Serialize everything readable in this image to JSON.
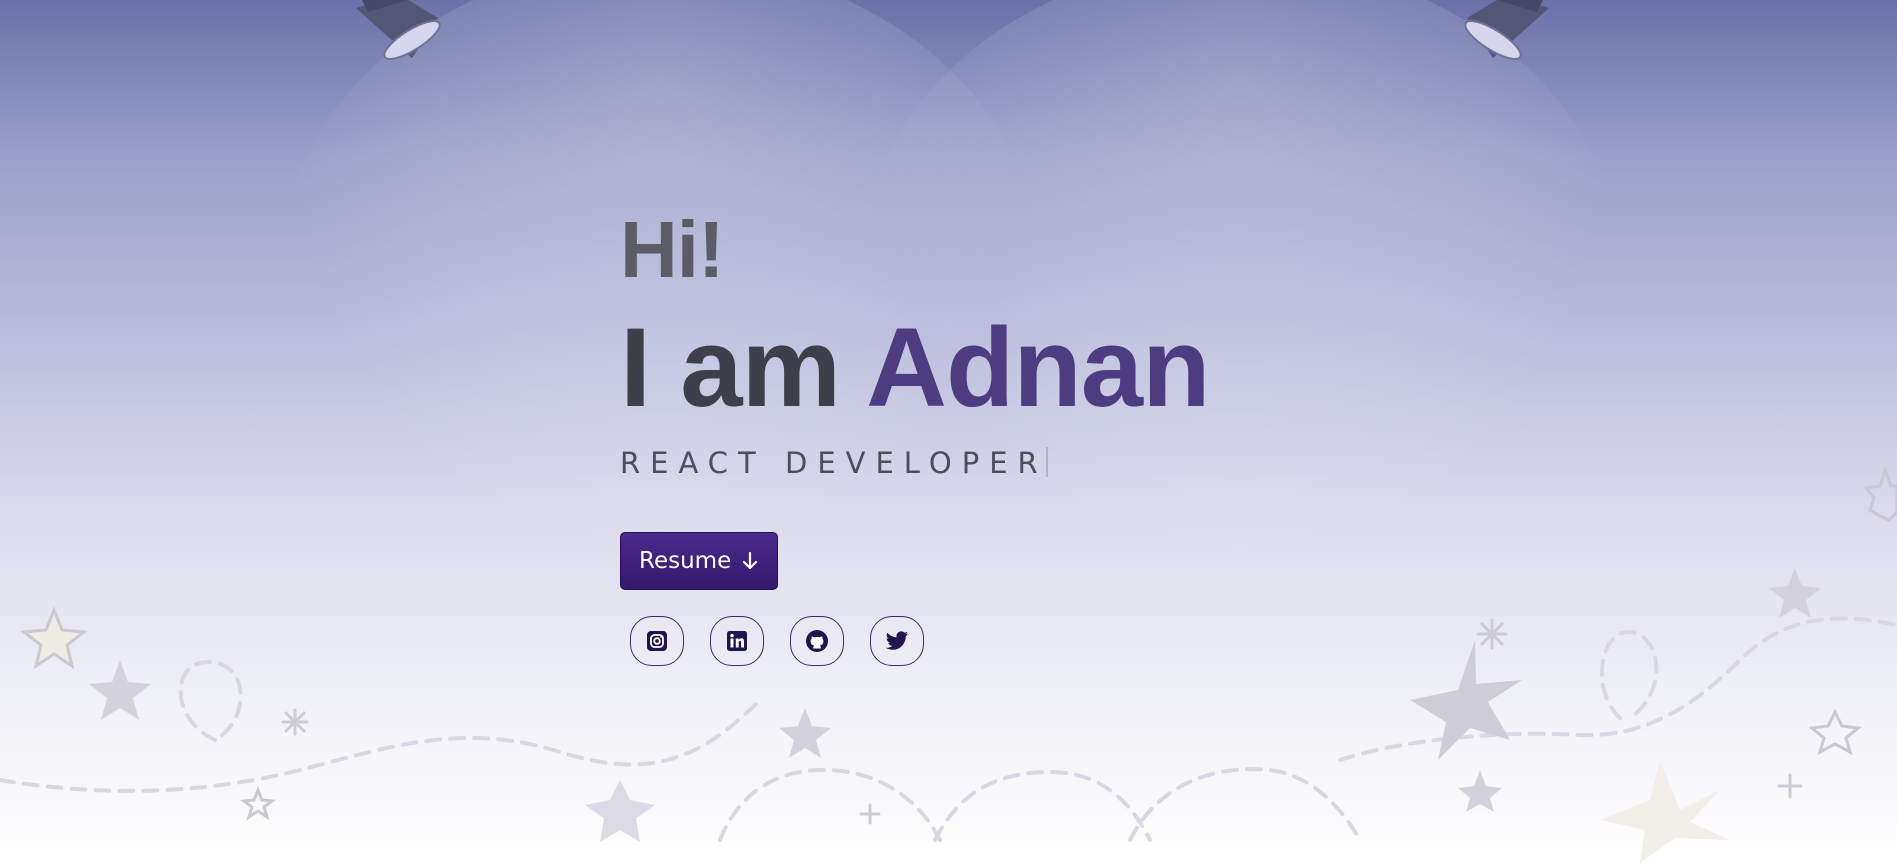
{
  "hero": {
    "greeting": "Hi!",
    "name_prefix": "I am",
    "name": "Adnan",
    "role": "REACT DEVELOPER"
  },
  "actions": {
    "resume_label": "Resume",
    "resume_icon": "arrow-down-icon"
  },
  "socials": [
    {
      "name": "instagram",
      "icon": "instagram-icon"
    },
    {
      "name": "linkedin",
      "icon": "linkedin-icon"
    },
    {
      "name": "github",
      "icon": "github-icon"
    },
    {
      "name": "twitter",
      "icon": "twitter-icon"
    }
  ],
  "colors": {
    "accent": "#4d3d80",
    "button": "#3a1d78",
    "text_dark": "#3e3f4a",
    "text_muted": "#5b5c66"
  }
}
